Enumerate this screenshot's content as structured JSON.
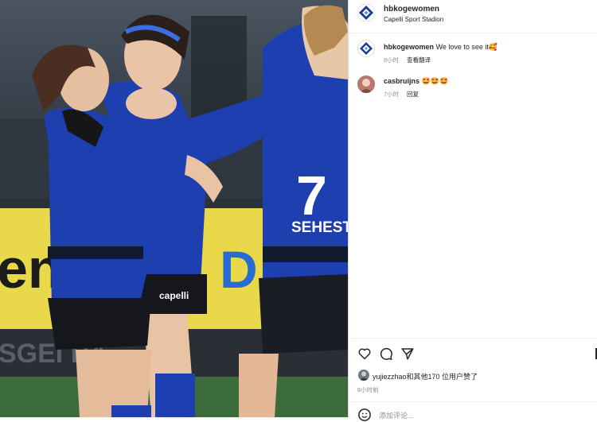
{
  "post": {
    "author": "hbkogewomen",
    "location": "Capelli Sport Stadion",
    "image_alt": "Soccer players in blue and black kits celebrating together",
    "jersey_number": "7",
    "jersey_sponsor": "SEHEST",
    "shorts_brand": "capelli",
    "banner_text_left": "en",
    "banner_text_right": "D",
    "board_text": "SGEI PÅ"
  },
  "comments": [
    {
      "author": "hbkogewomen",
      "text": "We love to see it🥰",
      "time": "8小时",
      "action": "查看翻译"
    },
    {
      "author": "casbruijns",
      "text": "🤩🤩🤩",
      "time": "7小时",
      "action": "回复"
    }
  ],
  "likes": {
    "text": "yujiezzhao和其他170 位用户赞了",
    "time": "8小时前"
  },
  "add_comment": {
    "placeholder": "添加评论..."
  },
  "colors": {
    "brand_blue": "#1e3a8a",
    "text": "#262626",
    "muted": "#8e8e8e"
  }
}
